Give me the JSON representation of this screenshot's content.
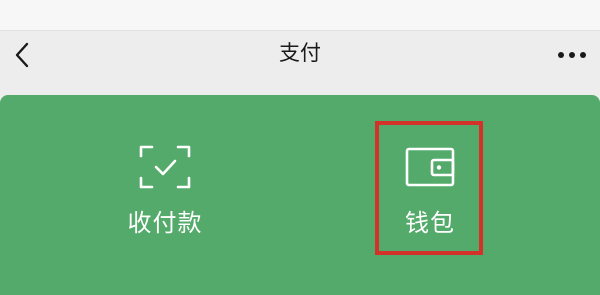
{
  "nav": {
    "title": "支付",
    "back_icon": "chevron-left-icon",
    "more_icon": "more-horizontal-icon"
  },
  "actions": [
    {
      "label": "收付款",
      "icon": "scan-check-icon"
    },
    {
      "label": "钱包",
      "icon": "wallet-icon"
    }
  ],
  "colors": {
    "card_background": "#53aa6a",
    "highlight": "#d4312a",
    "nav_background": "#ededed"
  }
}
